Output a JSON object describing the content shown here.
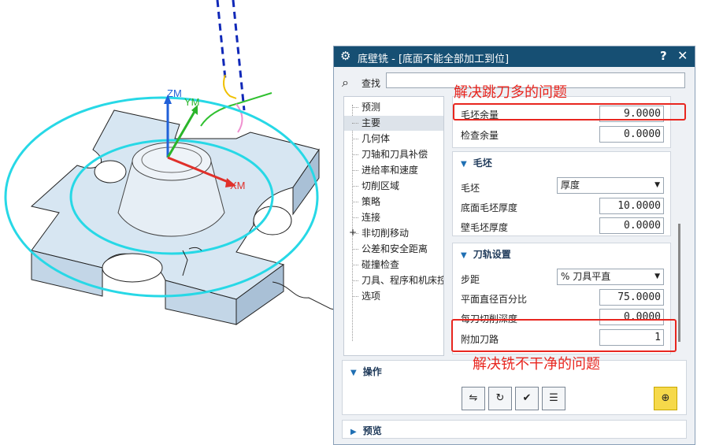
{
  "viewport": {
    "axis_labels": {
      "zm": "ZM",
      "ym": "YM",
      "xm": "XM"
    },
    "colors": {
      "wcs_ring": "#27d8e6",
      "part_fill": "#d7e6f2",
      "zm_axis": "#2060d8",
      "ym_axis": "#2ab52a",
      "xm_axis": "#e0302a"
    }
  },
  "dialog": {
    "title": "底壁铣 - [底面不能全部加工到位]",
    "gear_icon": "gear-icon",
    "help_label": "?",
    "close_label": "✕",
    "find": {
      "label": "查找",
      "icon": "binoculars-icon",
      "value": ""
    },
    "tree_items": [
      "预测",
      "主要",
      "几何体",
      "刀轴和刀具补偿",
      "进给率和速度",
      "切削区域",
      "策略",
      "连接",
      "非切削移动",
      "公差和安全距离",
      "碰撞检查",
      "刀具、程序和机床控制",
      "选项"
    ],
    "tree_selected_index": 1,
    "tree_expand_sign": "+",
    "allowance": {
      "blank_allowance_label": "毛坯余量",
      "blank_allowance_value": "9.0000",
      "check_allowance_label": "检查余量",
      "check_allowance_value": "0.0000"
    },
    "blank_section": {
      "title": "毛坯",
      "blank_label": "毛坯",
      "blank_value": "厚度",
      "bottom_thickness_label": "底面毛坯厚度",
      "bottom_thickness_value": "10.0000",
      "wall_thickness_label": "壁毛坯厚度",
      "wall_thickness_value": "0.0000"
    },
    "path_section": {
      "title": "刀轨设置",
      "stepover_label": "步距",
      "stepover_value": "% 刀具平直",
      "diameter_pct_label": "平面直径百分比",
      "diameter_pct_value": "75.0000",
      "depth_per_cut_label": "每刀切削深度",
      "depth_per_cut_value": "0.0000",
      "extra_passes_label": "附加刀路",
      "extra_passes_value": "1"
    },
    "actions": {
      "title": "操作",
      "buttons": [
        "generate-icon",
        "replay-icon",
        "verify-icon",
        "list-icon",
        "display-icon"
      ]
    },
    "preview": {
      "title": "预览"
    }
  },
  "annotations": {
    "top_note": "解决跳刀多的问题",
    "bottom_note": "解决铣不干净的问题",
    "color": "#e8261f"
  }
}
